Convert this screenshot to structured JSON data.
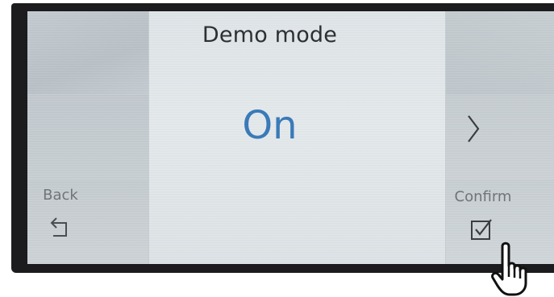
{
  "screen": {
    "title": "Demo mode",
    "value": "On",
    "back_label": "Back",
    "confirm_label": "Confirm"
  },
  "icons": {
    "back": "back-arrow-icon",
    "next": "chevron-right-icon",
    "confirm": "checkbox-check-icon",
    "pointer": "pointing-hand-icon"
  },
  "colors": {
    "value_accent": "#3a7ab8",
    "title_text": "#2d2f31",
    "secondary_text": "#6f7478",
    "bezel": "#1c1c1e"
  }
}
